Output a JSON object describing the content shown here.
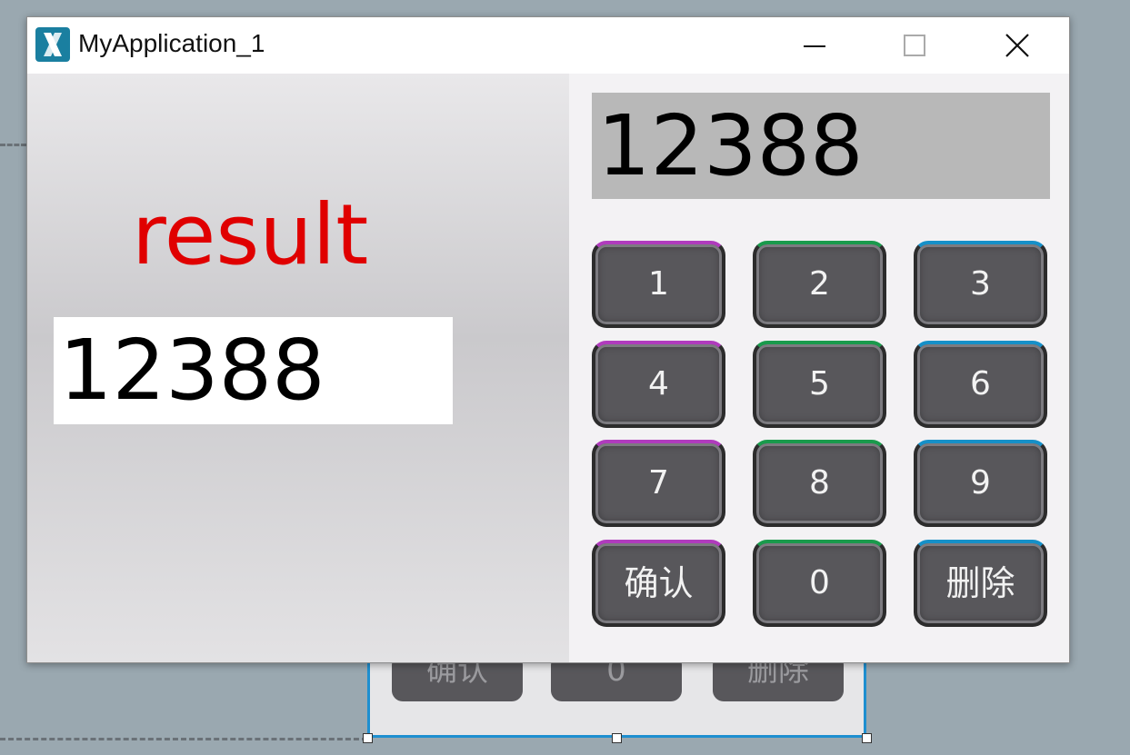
{
  "window": {
    "title": "MyApplication_1",
    "app_icon": "x-logo-icon",
    "controls": [
      "minimize-icon",
      "maximize-icon",
      "close-icon"
    ]
  },
  "left": {
    "label": "result",
    "value": "12388"
  },
  "right": {
    "display": "12388",
    "keys": [
      {
        "label": "1"
      },
      {
        "label": "2"
      },
      {
        "label": "3"
      },
      {
        "label": "4"
      },
      {
        "label": "5"
      },
      {
        "label": "6"
      },
      {
        "label": "7"
      },
      {
        "label": "8"
      },
      {
        "label": "9"
      },
      {
        "label": "确认"
      },
      {
        "label": "0"
      },
      {
        "label": "删除"
      }
    ]
  },
  "background_canvas": {
    "ghost_keys": [
      {
        "label": "确认"
      },
      {
        "label": "0"
      },
      {
        "label": "删除"
      }
    ]
  },
  "colors": {
    "accent_red": "#e00000",
    "key_face": "#58575b",
    "key_border_col1": "#b03bbd",
    "key_border_col2": "#1a9a4c",
    "key_border_col3": "#1690c8",
    "selection_blue": "#1e8fd0"
  }
}
